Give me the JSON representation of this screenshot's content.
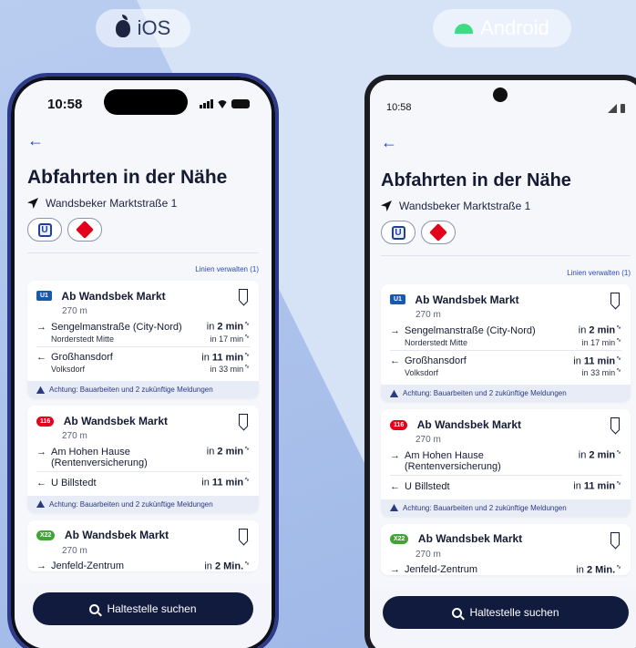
{
  "platforms": {
    "ios_label": "iOS",
    "android_label": "Android"
  },
  "ios": {
    "time": "10:58",
    "title": "Abfahrten in der Nähe",
    "location": "Wandsbeker Marktstraße 1",
    "manage_lines": "Linien verwalten (1)",
    "search_button": "Haltestelle suchen",
    "cards": [
      {
        "badge": "U1",
        "stop": "Ab Wandsbek Markt",
        "distance": "270 m",
        "departures": [
          {
            "arrow": "→",
            "destination": "Sengelmanstraße (City-Nord)",
            "time_prefix": "in",
            "time": "2 min",
            "via": "Norderstedt Mitte",
            "via_time": "in 17 min"
          },
          {
            "arrow": "←",
            "destination": "Großhansdorf",
            "time_prefix": "in",
            "time": "11 min",
            "via": "Volksdorf",
            "via_time": "in 33 min"
          }
        ],
        "warning": "Achtung: Bauarbeiten und 2 zukünftige Meldungen"
      },
      {
        "badge": "116",
        "stop": "Ab Wandsbek Markt",
        "distance": "270 m",
        "departures": [
          {
            "arrow": "→",
            "destination": "Am Hohen Hause (Rentenversicherung)",
            "time_prefix": "in",
            "time": "2 min"
          },
          {
            "arrow": "←",
            "destination": "U Billstedt",
            "time_prefix": "in",
            "time": "11 min"
          }
        ],
        "warning": "Achtung: Bauarbeiten und 2 zukünftige Meldungen"
      },
      {
        "badge": "X22",
        "stop": "Ab Wandsbek Markt",
        "distance": "270 m",
        "departures": [
          {
            "arrow": "→",
            "destination": "Jenfeld-Zentrum",
            "time_prefix": "in",
            "time": "2 Min."
          }
        ]
      }
    ]
  },
  "android": {
    "time": "10:58",
    "title": "Abfahrten in der Nähe",
    "location": "Wandsbeker Marktstraße 1",
    "manage_lines": "Linien verwalten (1)",
    "search_button": "Haltestelle suchen"
  },
  "colors": {
    "accent": "#2043c7",
    "dark_button": "#111b3d",
    "u1": "#1859a9",
    "bus": "#e2001a",
    "xpress": "#3fa535"
  },
  "icons": [
    "apple-icon",
    "android-icon",
    "back-arrow-icon",
    "location-arrow-icon",
    "u-bahn-icon",
    "db-icon",
    "bookmark-icon",
    "warning-icon",
    "search-icon",
    "realtime-icon"
  ]
}
